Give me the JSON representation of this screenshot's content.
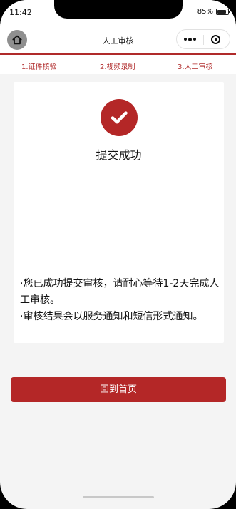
{
  "status_bar": {
    "time": "11:42",
    "battery": "85%"
  },
  "navigation": {
    "title": "人工审核"
  },
  "steps": [
    {
      "label": "1.证件核验"
    },
    {
      "label": "2.视频录制"
    },
    {
      "label": "3.人工审核"
    }
  ],
  "result": {
    "title": "提交成功",
    "messages": [
      "·您已成功提交审核，请耐心等待1-2天完成人工审核。",
      "·审核结果会以服务通知和短信形式通知。"
    ]
  },
  "actions": {
    "back_home": "回到首页"
  },
  "theme": {
    "accent": "#b42727",
    "background": "#f4f4f4"
  },
  "icons": {
    "home": "home-icon",
    "more": "more-icon",
    "close": "close-circle-icon",
    "success": "checkmark-icon"
  }
}
